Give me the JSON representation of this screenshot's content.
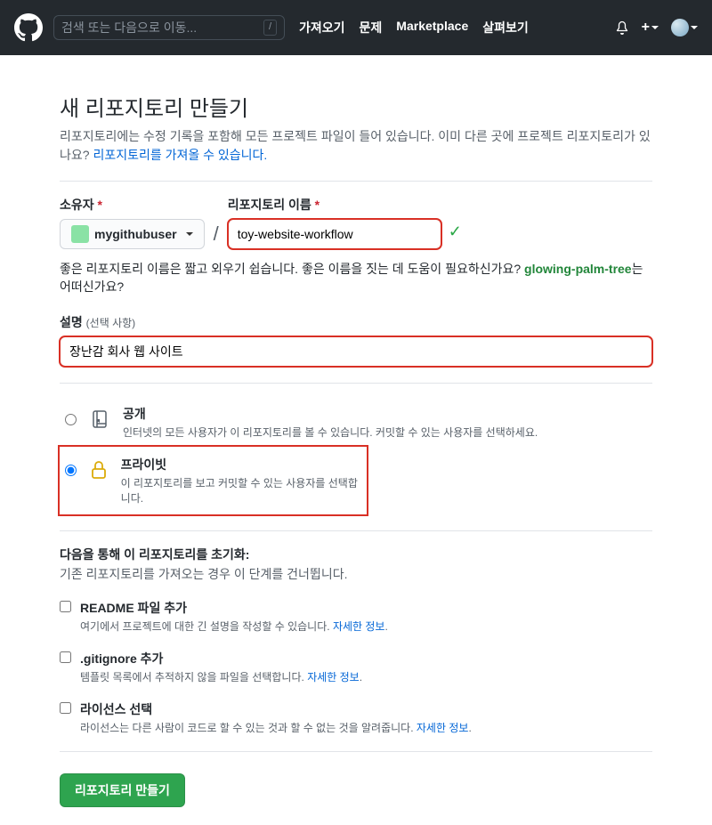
{
  "header": {
    "search_placeholder": "검색 또는 다음으로 이동...",
    "slash_key": "/",
    "nav": {
      "pull": "가져오기",
      "issues": "문제",
      "marketplace": "Marketplace",
      "explore": "살펴보기"
    },
    "plus_label": "+"
  },
  "page": {
    "title": "새 리포지토리 만들기",
    "subhead_before": "리포지토리에는 수정 기록을 포함해 모든 프로젝트 파일이 들어 있습니다. 이미 다른 곳에 프로젝트 리포지토리가 있나요? ",
    "subhead_link": "리포지토리를 가져올 수 있습니다."
  },
  "owner": {
    "label": "소유자",
    "name": "mygithubuser"
  },
  "repo": {
    "label": "리포지토리 이름",
    "value": "toy-website-workflow",
    "hint_before": "좋은 리포지토리 이름은 짧고 외우기 쉽습니다. 좋은 이름을 짓는 데 도움이 필요하신가요? ",
    "suggest": "glowing-palm-tree",
    "hint_after": "는 어떠신가요?"
  },
  "description": {
    "label": "설명",
    "optional": "(선택 사항)",
    "value": "장난감 회사 웹 사이트"
  },
  "visibility": {
    "public": {
      "title": "공개",
      "subtitle": "인터넷의 모든 사용자가 이 리포지토리를 볼 수 있습니다. 커밋할 수 있는 사용자를 선택하세요."
    },
    "private": {
      "title": "프라이빗",
      "subtitle": "이 리포지토리를 보고 커밋할 수 있는 사용자를 선택합니다."
    }
  },
  "init": {
    "heading": "다음을 통해 이 리포지토리를 초기화:",
    "sub": "기존 리포지토리를 가져오는 경우 이 단계를 건너뜁니다.",
    "readme": {
      "title": "README 파일 추가",
      "subtitle": "여기에서 프로젝트에 대한 긴 설명을 작성할 수 있습니다. ",
      "link": "자세한 정보"
    },
    "gitignore": {
      "title": ".gitignore 추가",
      "subtitle": "템플릿 목록에서 추적하지 않을 파일을 선택합니다. ",
      "link": "자세한 정보"
    },
    "license": {
      "title": "라이선스 선택",
      "subtitle": "라이선스는 다른 사람이 코드로 할 수 있는 것과 할 수 없는 것을 알려줍니다. ",
      "link": "자세한 정보"
    }
  },
  "create_button": "리포지토리 만들기",
  "period": "."
}
